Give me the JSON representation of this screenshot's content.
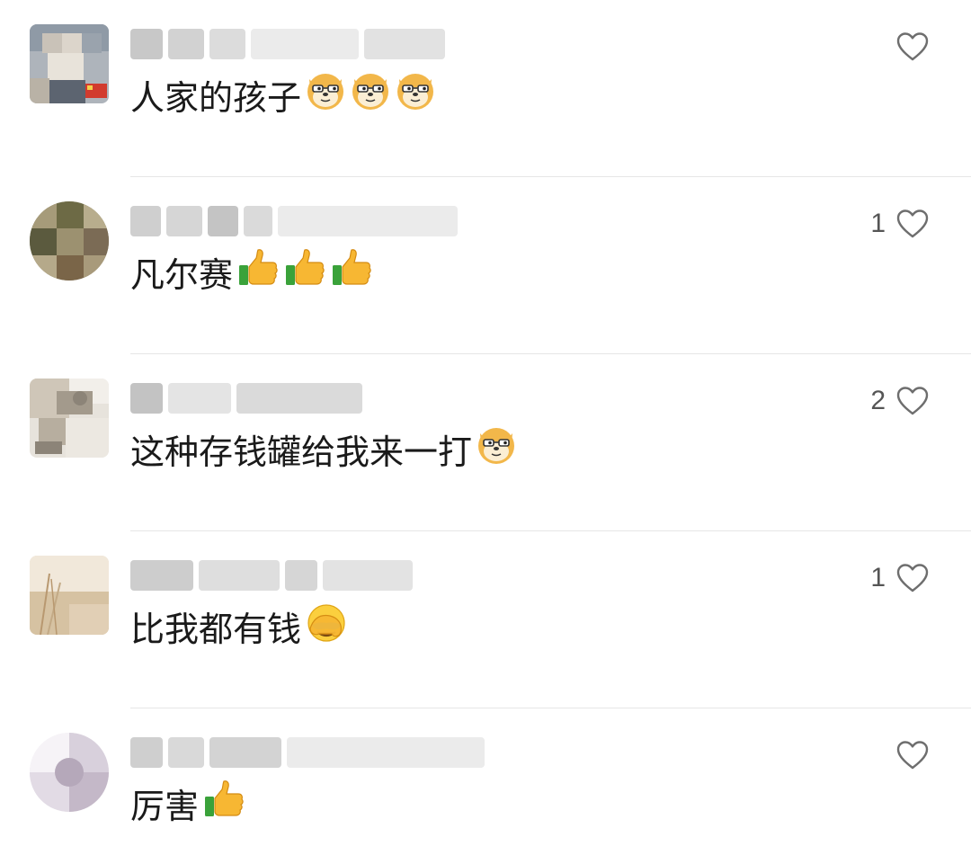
{
  "comments": [
    {
      "text": "人家的孩子",
      "emojis": [
        "doge-icon",
        "doge-icon",
        "doge-icon"
      ],
      "likes": "",
      "avatar_colors": [
        "#8f9aa6",
        "#c9c2b8",
        "#5c6470",
        "#e8e3da",
        "#b9b2a6",
        "#d23b2e"
      ]
    },
    {
      "text": "凡尔赛",
      "emojis": [
        "thumbs-up-icon",
        "thumbs-up-icon",
        "thumbs-up-icon"
      ],
      "likes": "1",
      "avatar_colors": [
        "#8d8560",
        "#6d6a45",
        "#a69b7a",
        "#5b5a3e",
        "#b8ad8d",
        "#7b6b55"
      ]
    },
    {
      "text": "这种存钱罐给我来一打",
      "emojis": [
        "doge-icon"
      ],
      "likes": "2",
      "avatar_colors": [
        "#e7e3dc",
        "#cfc6b8",
        "#a39a8c",
        "#8c8478",
        "#f2efea",
        "#b7ae9f"
      ]
    },
    {
      "text": "比我都有钱",
      "emojis": [
        "facepalm-crying-icon"
      ],
      "likes": "1",
      "avatar_colors": [
        "#e9dcc9",
        "#d6c2a2",
        "#c3aa86",
        "#f1e8da",
        "#b89870",
        "#e1cfb5"
      ]
    },
    {
      "text": "厉害",
      "emojis": [
        "thumbs-up-icon"
      ],
      "likes": "",
      "avatar_colors": [
        "#eeeaf0",
        "#d8d0dc",
        "#c4b8c8",
        "#f6f3f7",
        "#b5a8ba",
        "#e2dbe5"
      ]
    }
  ],
  "colors": {
    "heart_outline": "#6e6e6e",
    "divider": "#e6e6e6",
    "name_blur": "#d9d9d9"
  }
}
